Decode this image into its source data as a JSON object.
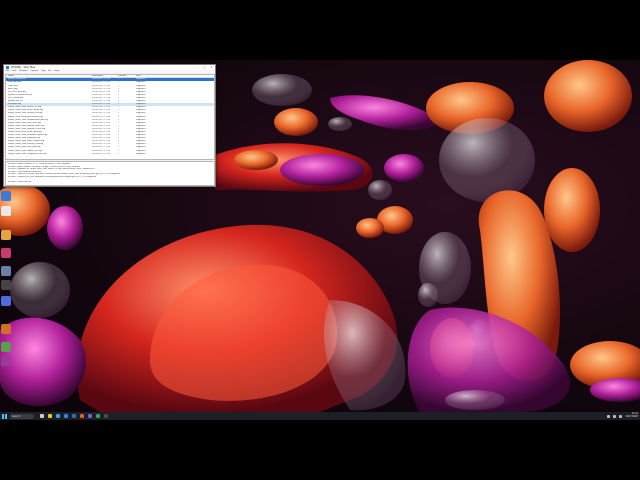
{
  "window": {
    "title": "SVS(MS) - Stop Files",
    "menus": [
      "File",
      "Edit",
      "Disassm",
      "Options",
      "Reg",
      "Ext",
      "Help"
    ],
    "columns": [
      "Name",
      "Lastmodify",
      "Size(kb)",
      "Note"
    ],
    "rows": [
      {
        "name": "Ryobot_script.exe",
        "date": "2023-10-17 11:10",
        "size": "1",
        "note": "Fragment"
      },
      {
        "name": "Stop_AR.bmp",
        "date": "2023-10-17 11:10",
        "size": "1",
        "note": "Fragment"
      },
      {
        "name": "Stack.prp",
        "date": "2023-10-17 11:10",
        "size": "1",
        "note": "Fragment"
      },
      {
        "name": "Boot_flag",
        "date": "2023-10-17 11:10",
        "size": "1",
        "note": "Fragment"
      },
      {
        "name": "SVS_IMG_NEW.bin",
        "date": "2023-10-17 11:10",
        "size": "1",
        "note": "Fragment"
      },
      {
        "name": "System_Permissions.clb",
        "date": "2023-10-17 11:10",
        "size": "1",
        "note": "Fragment"
      },
      {
        "name": "SVS_Config.dat",
        "date": "2023-10-17 11:10",
        "size": "1",
        "note": "Fragment"
      },
      {
        "name": "prueba_del.crc",
        "date": "2023-10-17 11:10",
        "size": "1",
        "note": "Fragment"
      },
      {
        "name": "SVSlog00.log",
        "date": "2023-10-17 11:10",
        "size": "1",
        "note": "Fragment"
      },
      {
        "name": "Purple_stone_task_runner_01.log",
        "date": "2023-10-17 11:10",
        "size": "1",
        "note": "Fragment"
      },
      {
        "name": "Purple_stone_task_script_alpha.log",
        "date": "2023-10-17 11:10",
        "size": "1",
        "note": "Fragment"
      },
      {
        "name": "Purple_stone_task_overlay_old.log",
        "date": "2023-10-17 11:10",
        "size": "1",
        "note": "Fragment"
      },
      {
        "name": "Purple_stone_task_permissions.log",
        "date": "2023-10-17 11:10",
        "size": "1",
        "note": "Fragment"
      },
      {
        "name": "Purple_stone_task_compression_dat.log",
        "date": "2023-10-17 11:10",
        "size": "1",
        "note": "Fragment"
      },
      {
        "name": "Purple_stone_task_fatal_error.log",
        "date": "2023-10-17 11:10",
        "size": "1",
        "note": "Fragment"
      },
      {
        "name": "Purple_stone_task_backup_main.log",
        "date": "2023-10-17 11:10",
        "size": "1",
        "note": "Fragment"
      },
      {
        "name": "Purple_stone_task_manual_check.log",
        "date": "2023-10-17 11:10",
        "size": "1",
        "note": "Fragment"
      },
      {
        "name": "Purple_stone_task_extra_data.log",
        "date": "2023-10-17 11:10",
        "size": "1",
        "note": "Fragment"
      },
      {
        "name": "Purple_stone_task_FinalBoss_layout.log",
        "date": "2023-10-17 11:10",
        "size": "1",
        "note": "Fragment"
      },
      {
        "name": "Purple_stone_task_scalibility.log",
        "date": "2023-10-17 11:10",
        "size": "1",
        "note": "Fragment"
      },
      {
        "name": "Purple_stone_task_index_hidden.log",
        "date": "2023-10-17 11:10",
        "size": "1",
        "note": "Fragment"
      },
      {
        "name": "Purple_stone_task_overlay_new.log",
        "date": "2023-10-17 11:10",
        "size": "1",
        "note": "Fragment"
      },
      {
        "name": "Purple_stone_task_Seal_final.log",
        "date": "2023-10-17 11:10",
        "size": "1",
        "note": "Fragment"
      },
      {
        "name": "Purple_stone_task_hidden_ext.log",
        "date": "2023-10-17 11:10",
        "size": "1",
        "note": "Fragment"
      },
      {
        "name": "Purple_stone_task_temporary_files.log",
        "date": "2023-10-17 11:10",
        "size": "1",
        "note": "Fragment"
      }
    ],
    "log_lines": [
      "SVS(MS) Loaded (Version 3.13) - Fixed all errors of 'Skill' program",
      "SVS(MS) system loaded - Memory: 1.80gb - Connected to SVS_IMG_NEW.bin",
      "SVS(MS): Fragment of 'Purple_stone_task_runner_01.log' found in block 1824 - Reported FYI",
      "SVS(MS): SVS compiler Terminated",
      "SVS(MS): Opened: SVS_IMG_NEW.bin:c://svs/tool/system/Purple_stone_task_temporary_files.log 10-17 11:10 Fragment",
      "SVS(MS): Opened: SVS_IMG_NEW.bin:c://svs/tool/system/SVSlog00.log 10-17 11:10 Fragment",
      "",
      "SVS(MS)> Select(sm.no)"
    ]
  },
  "taskbar": {
    "search_text": "Search",
    "time": "11:10",
    "date": "10/17/2023"
  }
}
